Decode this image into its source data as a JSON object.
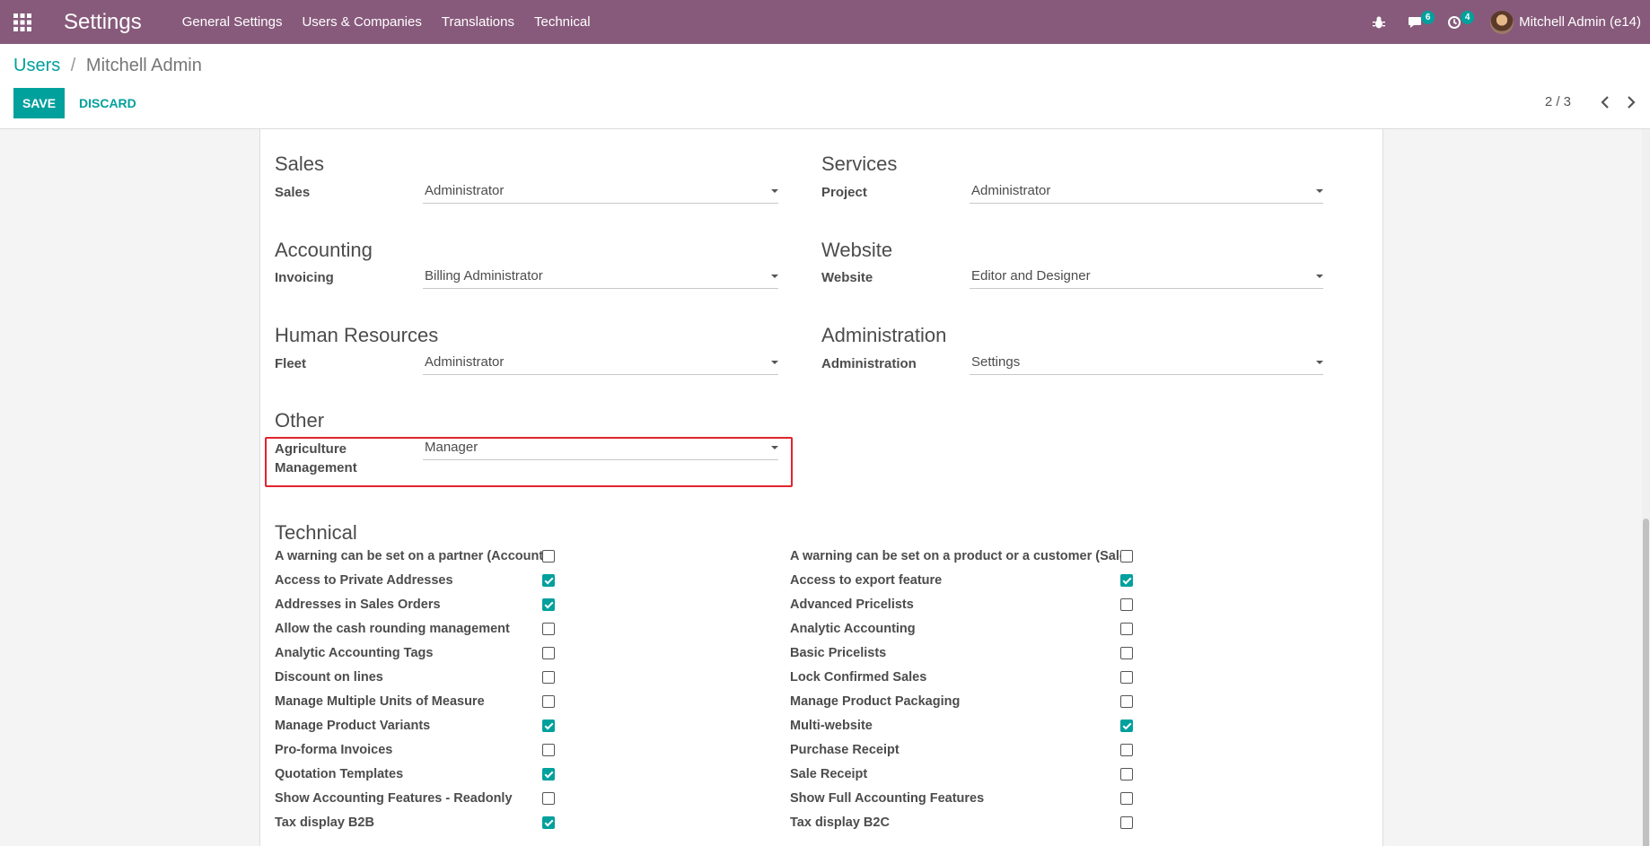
{
  "navbar": {
    "app_title": "Settings",
    "menu": [
      "General Settings",
      "Users & Companies",
      "Translations",
      "Technical"
    ],
    "messages_count": "6",
    "activities_count": "4",
    "user_name": "Mitchell Admin (e14)",
    "bg_color": "#875a7b"
  },
  "breadcrumb": {
    "parent": "Users",
    "separator": "/",
    "current": "Mitchell Admin"
  },
  "actions": {
    "save": "SAVE",
    "discard": "DISCARD"
  },
  "pager": {
    "value": "2 / 3"
  },
  "groups": {
    "sales": {
      "title": "Sales",
      "label": "Sales",
      "value": "Administrator"
    },
    "services": {
      "title": "Services",
      "label": "Project",
      "value": "Administrator"
    },
    "accounting": {
      "title": "Accounting",
      "label": "Invoicing",
      "value": "Billing Administrator"
    },
    "website": {
      "title": "Website",
      "label": "Website",
      "value": "Editor and Designer"
    },
    "hr": {
      "title": "Human Resources",
      "label": "Fleet",
      "value": "Administrator"
    },
    "administration": {
      "title": "Administration",
      "label": "Administration",
      "value": "Settings"
    },
    "other": {
      "title": "Other",
      "label_line1": "Agriculture",
      "label_line2": "Management",
      "value": "Manager"
    }
  },
  "technical": {
    "title": "Technical",
    "left": [
      {
        "label": "A warning can be set on a partner (Account)",
        "checked": false
      },
      {
        "label": "Access to Private Addresses",
        "checked": true
      },
      {
        "label": "Addresses in Sales Orders",
        "checked": true
      },
      {
        "label": "Allow the cash rounding management",
        "checked": false
      },
      {
        "label": "Analytic Accounting Tags",
        "checked": false
      },
      {
        "label": "Discount on lines",
        "checked": false
      },
      {
        "label": "Manage Multiple Units of Measure",
        "checked": false
      },
      {
        "label": "Manage Product Variants",
        "checked": true
      },
      {
        "label": "Pro-forma Invoices",
        "checked": false
      },
      {
        "label": "Quotation Templates",
        "checked": true
      },
      {
        "label": "Show Accounting Features - Readonly",
        "checked": false
      },
      {
        "label": "Tax display B2B",
        "checked": true
      }
    ],
    "right": [
      {
        "label": "A warning can be set on a product or a customer (Sale)",
        "checked": false
      },
      {
        "label": "Access to export feature",
        "checked": true
      },
      {
        "label": "Advanced Pricelists",
        "checked": false
      },
      {
        "label": "Analytic Accounting",
        "checked": false
      },
      {
        "label": "Basic Pricelists",
        "checked": false
      },
      {
        "label": "Lock Confirmed Sales",
        "checked": false
      },
      {
        "label": "Manage Product Packaging",
        "checked": false
      },
      {
        "label": "Multi-website",
        "checked": true
      },
      {
        "label": "Purchase Receipt",
        "checked": false
      },
      {
        "label": "Sale Receipt",
        "checked": false
      },
      {
        "label": "Show Full Accounting Features",
        "checked": false
      },
      {
        "label": "Tax display B2C",
        "checked": false
      }
    ]
  },
  "colors": {
    "accent": "#00a09d",
    "highlight": "#e0242e"
  }
}
